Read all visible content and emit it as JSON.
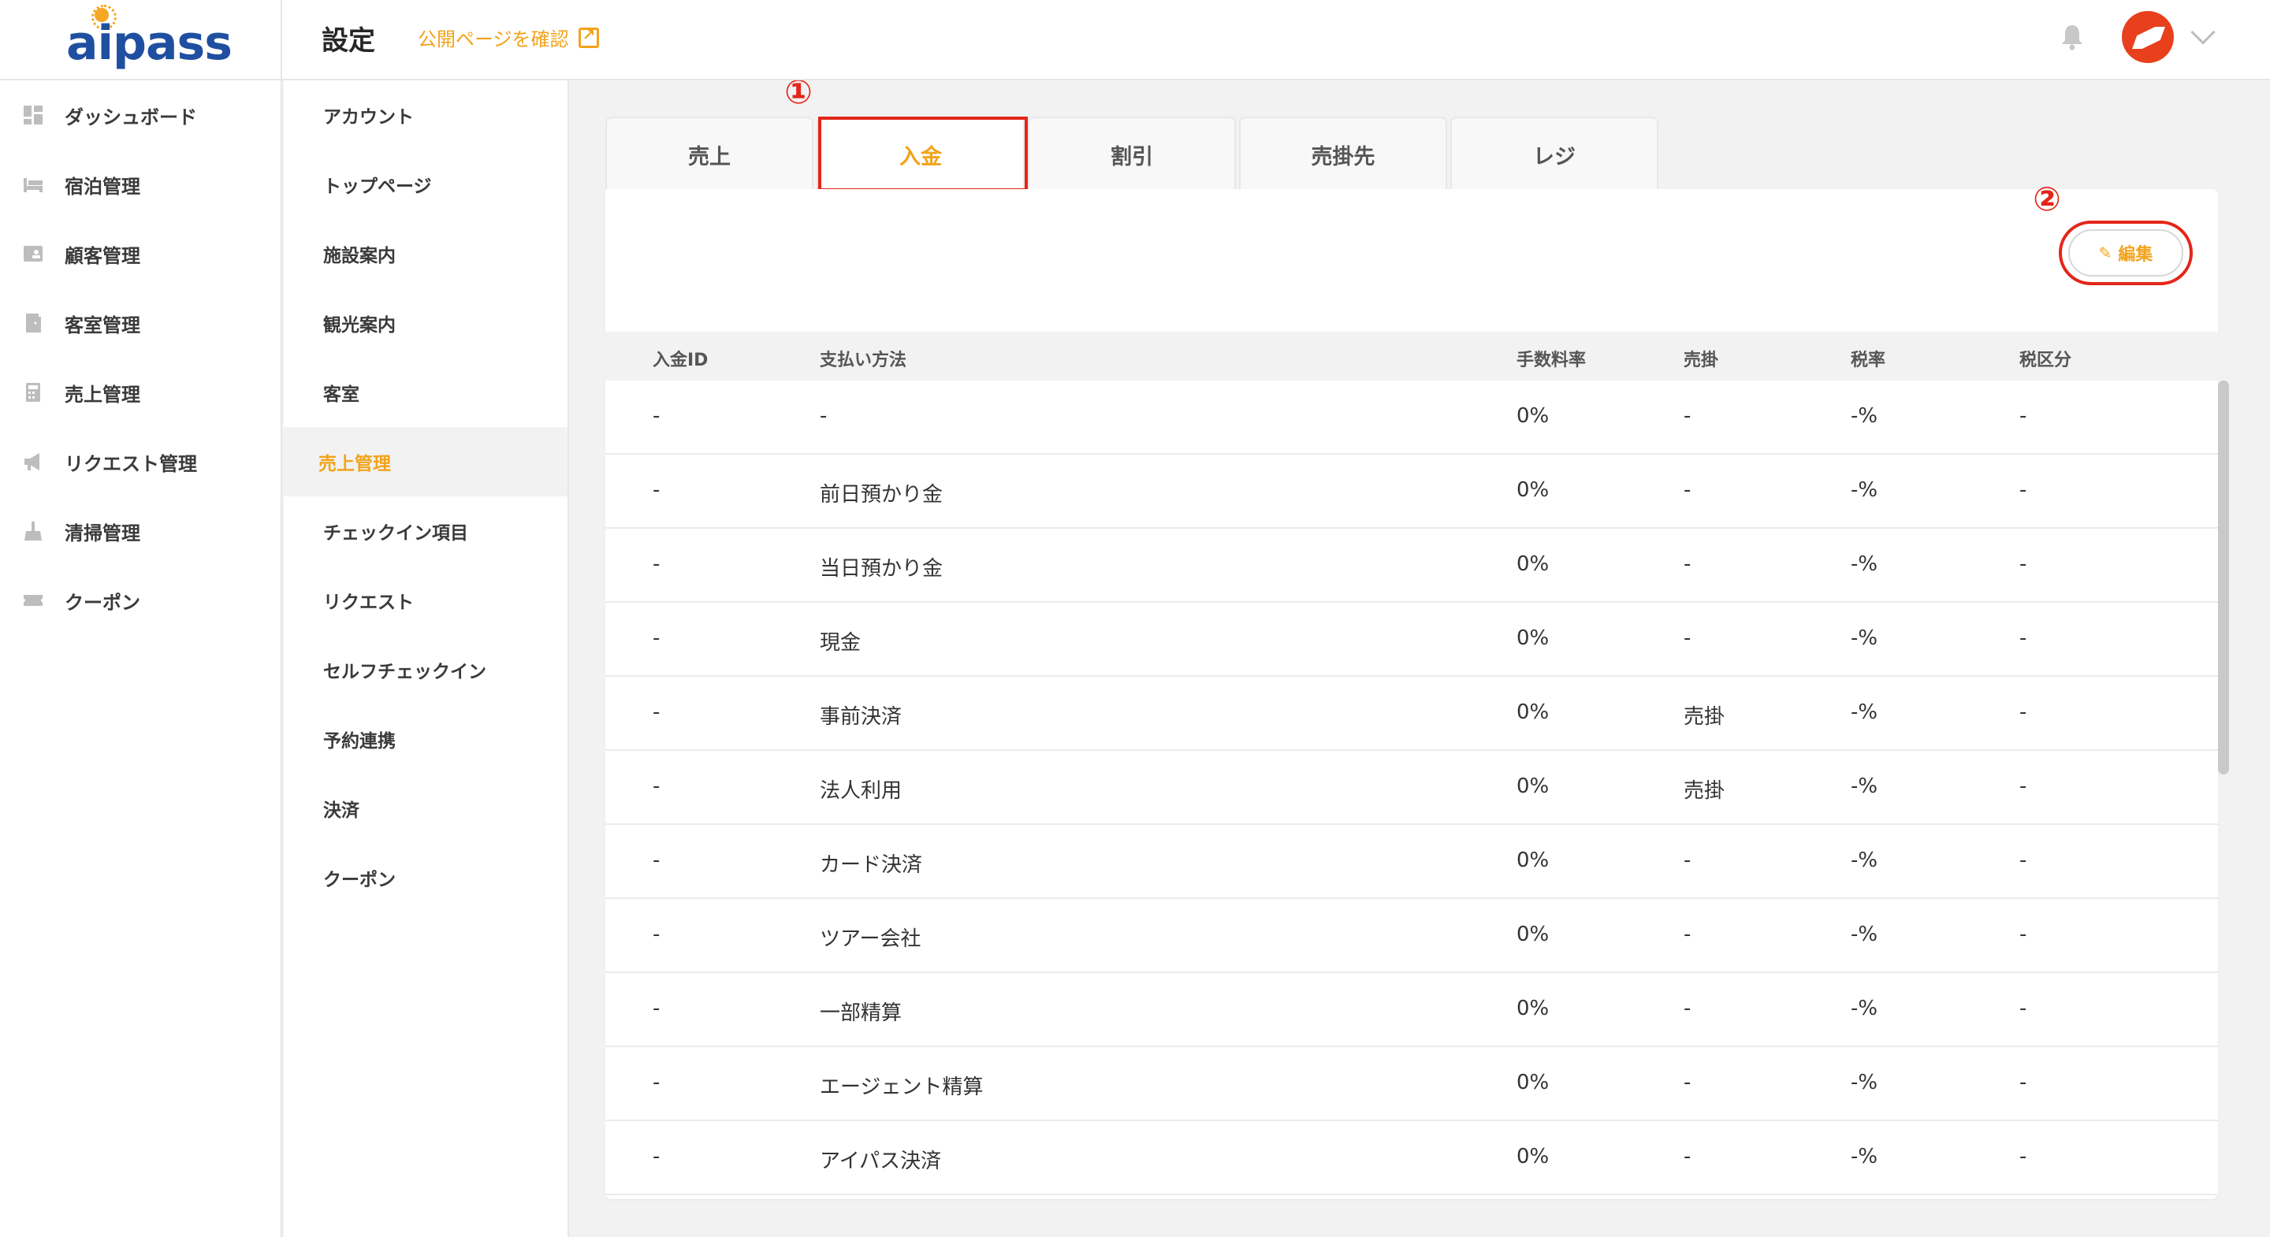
{
  "brand": {
    "logo_text": "aipass"
  },
  "header": {
    "title": "設定",
    "public_link": "公開ページを確認"
  },
  "sidebar": {
    "items": [
      {
        "label": "ダッシュボード",
        "icon": "dashboard-icon"
      },
      {
        "label": "宿泊管理",
        "icon": "bed-icon"
      },
      {
        "label": "顧客管理",
        "icon": "customer-card-icon"
      },
      {
        "label": "客室管理",
        "icon": "door-icon"
      },
      {
        "label": "売上管理",
        "icon": "calculator-icon"
      },
      {
        "label": "リクエスト管理",
        "icon": "megaphone-icon"
      },
      {
        "label": "清掃管理",
        "icon": "broom-icon"
      },
      {
        "label": "クーポン",
        "icon": "ticket-icon"
      }
    ]
  },
  "settings_nav": {
    "items": [
      {
        "label": "アカウント"
      },
      {
        "label": "トップページ"
      },
      {
        "label": "施設案内"
      },
      {
        "label": "観光案内"
      },
      {
        "label": "客室"
      },
      {
        "label": "売上管理",
        "active": true
      },
      {
        "label": "チェックイン項目"
      },
      {
        "label": "リクエスト"
      },
      {
        "label": "セルフチェックイン"
      },
      {
        "label": "予約連携"
      },
      {
        "label": "決済"
      },
      {
        "label": "クーポン"
      }
    ]
  },
  "tabs": [
    {
      "label": "売上"
    },
    {
      "label": "入金",
      "active": true
    },
    {
      "label": "割引"
    },
    {
      "label": "売掛先"
    },
    {
      "label": "レジ"
    }
  ],
  "markers": {
    "one": "①",
    "two": "②"
  },
  "edit_button": {
    "label": "編集"
  },
  "table": {
    "headers": [
      "入金ID",
      "支払い方法",
      "手数料率",
      "売掛",
      "税率",
      "税区分"
    ],
    "rows": [
      [
        "-",
        "-",
        "0%",
        "-",
        "-%",
        "-"
      ],
      [
        "-",
        "前日預かり金",
        "0%",
        "-",
        "-%",
        "-"
      ],
      [
        "-",
        "当日預かり金",
        "0%",
        "-",
        "-%",
        "-"
      ],
      [
        "-",
        "現金",
        "0%",
        "-",
        "-%",
        "-"
      ],
      [
        "-",
        "事前決済",
        "0%",
        "売掛",
        "-%",
        "-"
      ],
      [
        "-",
        "法人利用",
        "0%",
        "売掛",
        "-%",
        "-"
      ],
      [
        "-",
        "カード決済",
        "0%",
        "-",
        "-%",
        "-"
      ],
      [
        "-",
        "ツアー会社",
        "0%",
        "-",
        "-%",
        "-"
      ],
      [
        "-",
        "一部精算",
        "0%",
        "-",
        "-%",
        "-"
      ],
      [
        "-",
        "エージェント精算",
        "0%",
        "-",
        "-%",
        "-"
      ],
      [
        "-",
        "アイパス決済",
        "0%",
        "-",
        "-%",
        "-"
      ]
    ]
  },
  "colors": {
    "accent": "#f2a31a",
    "highlight": "#e32619",
    "brand": "#1f4fa0"
  }
}
